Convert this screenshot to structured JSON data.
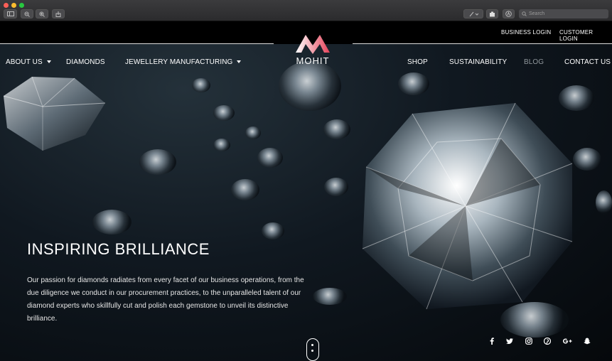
{
  "chrome": {
    "search_placeholder": "Search"
  },
  "top_links": {
    "business_login": "BUSINESS LOGIN",
    "customer_login": "CUSTOMER LOGIN"
  },
  "logo": {
    "text": "MOHIT"
  },
  "nav": {
    "about_us": "ABOUT US",
    "diamonds": "DIAMONDS",
    "jewellery_manufacturing": "JEWELLERY MANUFACTURING",
    "shop": "SHOP",
    "sustainability": "SUSTAINABILITY",
    "blog": "BLOG",
    "contact_us": "CONTACT US"
  },
  "hero": {
    "headline": "INSPIRING BRILLIANCE",
    "paragraph": "Our passion for diamonds radiates from every facet of our business operations, from the due diligence we conduct in our procurement practices, to the unparalleled talent of our diamond experts who skillfully cut and polish each gemstone to unveil its distinctive brilliance."
  },
  "social": [
    "facebook-icon",
    "twitter-icon",
    "instagram-icon",
    "pinterest-icon",
    "google-plus-icon",
    "snapchat-icon"
  ],
  "colors": {
    "logo_gradient_start": "#ffffff",
    "logo_gradient_end": "#e6435a",
    "nav_dim": "#8f969b"
  }
}
